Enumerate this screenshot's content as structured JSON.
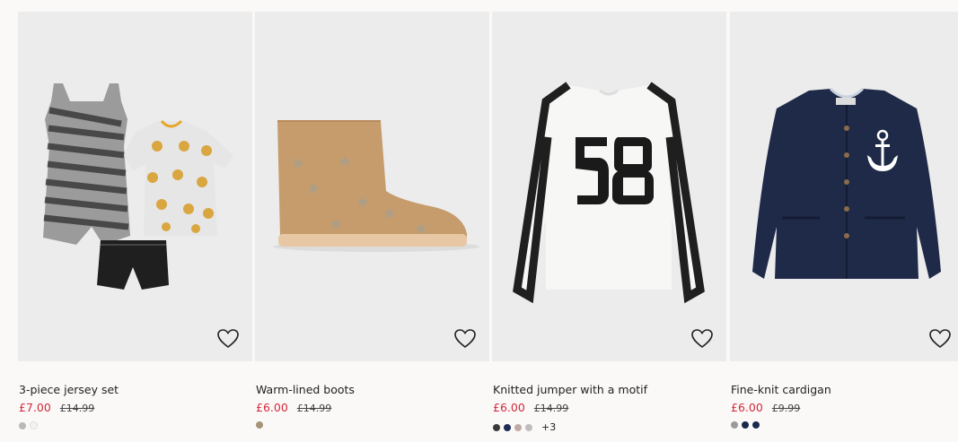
{
  "products": [
    {
      "title": "3-piece jersey set",
      "price": "£7.00",
      "old_price": "£14.99",
      "swatches": [
        "#b9b9b9",
        "#f3f3f3"
      ],
      "more": ""
    },
    {
      "title": "Warm-lined boots",
      "price": "£6.00",
      "old_price": "£14.99",
      "swatches": [
        "#a59476"
      ],
      "more": ""
    },
    {
      "title": "Knitted jumper with a motif",
      "price": "£6.00",
      "old_price": "£14.99",
      "swatches": [
        "#3a3a3a",
        "#1f2b57",
        "#c1a9a6",
        "#bdbdbd"
      ],
      "more": "+3"
    },
    {
      "title": "Fine-knit cardigan",
      "price": "£6.00",
      "old_price": "£9.99",
      "swatches": [
        "#9a9a9a",
        "#1b2a4b",
        "#1b2a4b"
      ],
      "more": ""
    }
  ],
  "icons": {
    "favourite": "heart-outline-icon"
  },
  "colors": {
    "sale_price": "#d5283b",
    "card_background": "#ececec",
    "page_background": "#faf9f8"
  }
}
